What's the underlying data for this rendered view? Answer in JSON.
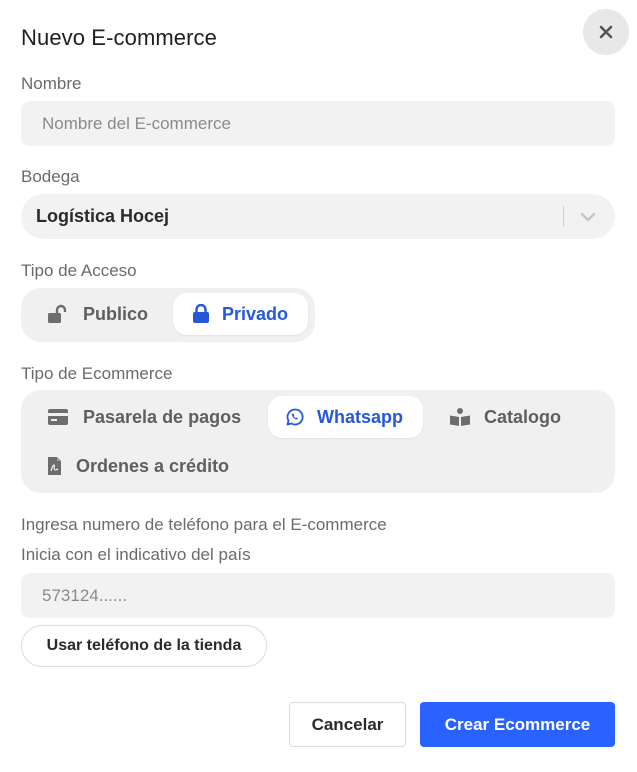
{
  "modal": {
    "title": "Nuevo E-commerce",
    "close_icon": "close-icon"
  },
  "nombre": {
    "label": "Nombre",
    "placeholder": "Nombre del E-commerce",
    "value": ""
  },
  "bodega": {
    "label": "Bodega",
    "selected": "Logística Hocej",
    "icon": "chevron-down-icon"
  },
  "tipo_acceso": {
    "label": "Tipo de Acceso",
    "options": [
      {
        "label": "Publico",
        "icon": "unlock-icon",
        "active": false
      },
      {
        "label": "Privado",
        "icon": "lock-icon",
        "active": true
      }
    ]
  },
  "tipo_ecommerce": {
    "label": "Tipo de Ecommerce",
    "options": [
      {
        "label": "Pasarela de pagos",
        "icon": "credit-card-icon",
        "active": false
      },
      {
        "label": "Whatsapp",
        "icon": "whatsapp-icon",
        "active": true
      },
      {
        "label": "Catalogo",
        "icon": "catalog-icon",
        "active": false
      },
      {
        "label": "Ordenes a crédito",
        "icon": "document-icon",
        "active": false
      }
    ]
  },
  "telefono": {
    "help_line1": "Ingresa numero de teléfono para el E-commerce",
    "help_line2": "Inicia con el indicativo del país",
    "placeholder": "573124......",
    "value": "",
    "store_phone_label": "Usar teléfono de la tienda"
  },
  "actions": {
    "cancel_label": "Cancelar",
    "create_label": "Crear Ecommerce"
  },
  "colors": {
    "accent": "#2962ff",
    "active_text": "#2559d7",
    "field_bg": "#f2f2f2"
  }
}
